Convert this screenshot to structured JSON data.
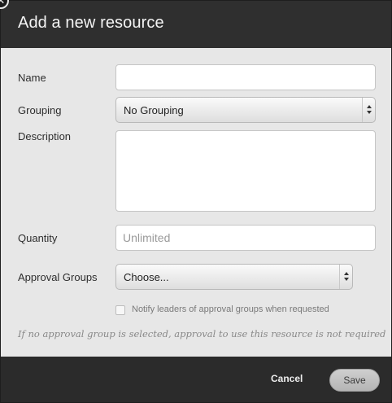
{
  "dialog": {
    "title": "Add a new resource",
    "close_icon": "close-icon",
    "close_glyph": "✕"
  },
  "form": {
    "name": {
      "label": "Name",
      "value": ""
    },
    "grouping": {
      "label": "Grouping",
      "selected": "No Grouping"
    },
    "description": {
      "label": "Description",
      "value": ""
    },
    "quantity": {
      "label": "Quantity",
      "value": "",
      "placeholder": "Unlimited"
    },
    "approval_groups": {
      "label": "Approval Groups",
      "selected": "Choose..."
    },
    "notify": {
      "label": "Notify leaders of approval groups when requested",
      "checked": false
    },
    "note": "If no approval group is selected, approval to use this resource is not required"
  },
  "footer": {
    "cancel_label": "Cancel",
    "save_label": "Save"
  },
  "colors": {
    "header_bg": "#2f2f2f",
    "body_bg": "#e7e7e7",
    "footer_bg": "#2b2b2b"
  }
}
